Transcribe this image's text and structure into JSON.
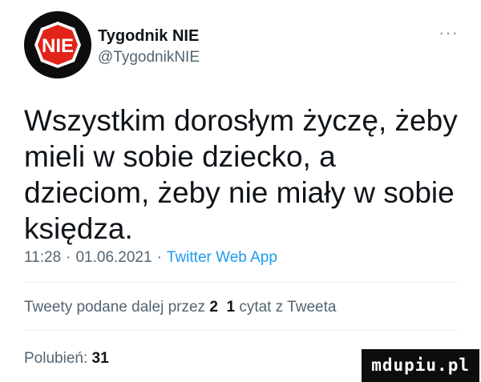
{
  "author": {
    "display_name": "Tygodnik NIE",
    "handle": "@TygodnikNIE",
    "avatar_text": "NIE"
  },
  "more_icon": "more-horizontal-icon",
  "tweet": {
    "text": "Wszystkim dorosłym życzę, żeby mieli w sobie dziecko, a dzieciom, żeby nie miały w sobie księdza.",
    "time": "11:28",
    "date": "01.06.2021",
    "separator": "·",
    "source": "Twitter Web App"
  },
  "stats": {
    "retweets_label": "Tweety podane dalej przez",
    "retweets_count": "2",
    "quotes_count": "1",
    "quotes_label": "cytat z Tweeta"
  },
  "likes": {
    "label": "Polubień:",
    "count": "31"
  },
  "watermark": {
    "text": "mdupiu.pl"
  },
  "colors": {
    "text": "#0f1419",
    "secondary": "#536471",
    "link": "#1d9bf0",
    "divider": "#e6ecf0",
    "avatar_red": "#e2231a"
  }
}
